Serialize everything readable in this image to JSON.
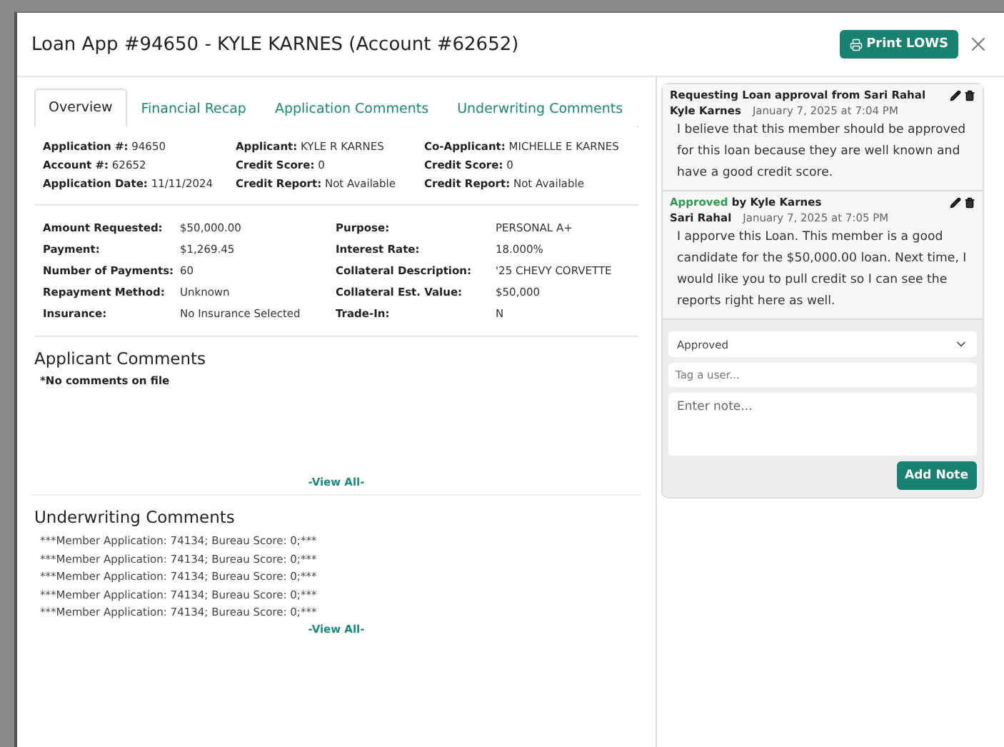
{
  "modal": {
    "title": "Loan App #94650 - KYLE KARNES (Account #62652)",
    "print_button": "Print LOWS"
  },
  "tabs": [
    {
      "label": "Overview",
      "selected": true
    },
    {
      "label": "Financial Recap",
      "selected": false
    },
    {
      "label": "Application Comments",
      "selected": false
    },
    {
      "label": "Underwriting Comments",
      "selected": false
    }
  ],
  "summary": [
    [
      {
        "label": "Application #:",
        "value": "94650"
      },
      {
        "label": "Account #:",
        "value": "62652"
      },
      {
        "label": "Application Date:",
        "value": "11/11/2024"
      }
    ],
    [
      {
        "label": "Applicant:",
        "value": "KYLE R KARNES"
      },
      {
        "label": "Credit Score:",
        "value": "0"
      },
      {
        "label": "Credit Report:",
        "value": "Not Available"
      }
    ],
    [
      {
        "label": "Co-Applicant:",
        "value": "MICHELLE E KARNES"
      },
      {
        "label": "Credit Score:",
        "value": "0"
      },
      {
        "label": "Credit Report:",
        "value": "Not Available"
      }
    ]
  ],
  "details": [
    [
      {
        "label": "Amount Requested:",
        "value": "$50,000.00"
      },
      {
        "label": "Payment:",
        "value": "$1,269.45"
      },
      {
        "label": "Number of Payments:",
        "value": "60"
      },
      {
        "label": "Repayment Method:",
        "value": "Unknown"
      },
      {
        "label": "Insurance:",
        "value": "No Insurance Selected"
      }
    ],
    [
      {
        "label": "Purpose:",
        "value": "PERSONAL A+"
      },
      {
        "label": "Interest Rate:",
        "value": "18.000%"
      },
      {
        "label": "Collateral Description:",
        "value": "'25 CHEVY CORVETTE"
      },
      {
        "label": "Collateral Est. Value:",
        "value": "$50,000"
      },
      {
        "label": "Trade-In:",
        "value": "N"
      }
    ]
  ],
  "applicant_comments": {
    "heading": "Applicant Comments",
    "empty_text": "*No comments on file",
    "view_all": "-View All-"
  },
  "underwriting_comments": {
    "heading": "Underwriting Comments",
    "lines": [
      "***Member Application: 74134; Bureau Score: 0;***",
      "***Member Application: 74134; Bureau Score: 0;***",
      "***Member Application: 74134; Bureau Score: 0;***",
      "***Member Application: 74134; Bureau Score: 0;***",
      "***Member Application: 74134; Bureau Score: 0;***"
    ],
    "view_all": "-View All-"
  },
  "notes": [
    {
      "kind": "request",
      "header": "Requesting Loan approval from Sari Rahal",
      "author": "Kyle Karnes",
      "date": "January 7, 2025 at 7:04 PM",
      "body": "I believe that this member should be approved for this loan because they are well known and have a good credit score."
    },
    {
      "kind": "status",
      "status": "Approved",
      "header": "by Kyle Karnes",
      "author": "Sari Rahal",
      "date": "January 7, 2025 at 7:05 PM",
      "body": "I apporve this Loan. This member is a good candidate for the $50,000.00 loan. Next time, I would like you to pull credit so I can see the reports right here as well."
    }
  ],
  "note_form": {
    "status_value": "Approved",
    "tag_placeholder": "Tag a user...",
    "note_placeholder": "Enter note...",
    "submit": "Add Note"
  }
}
